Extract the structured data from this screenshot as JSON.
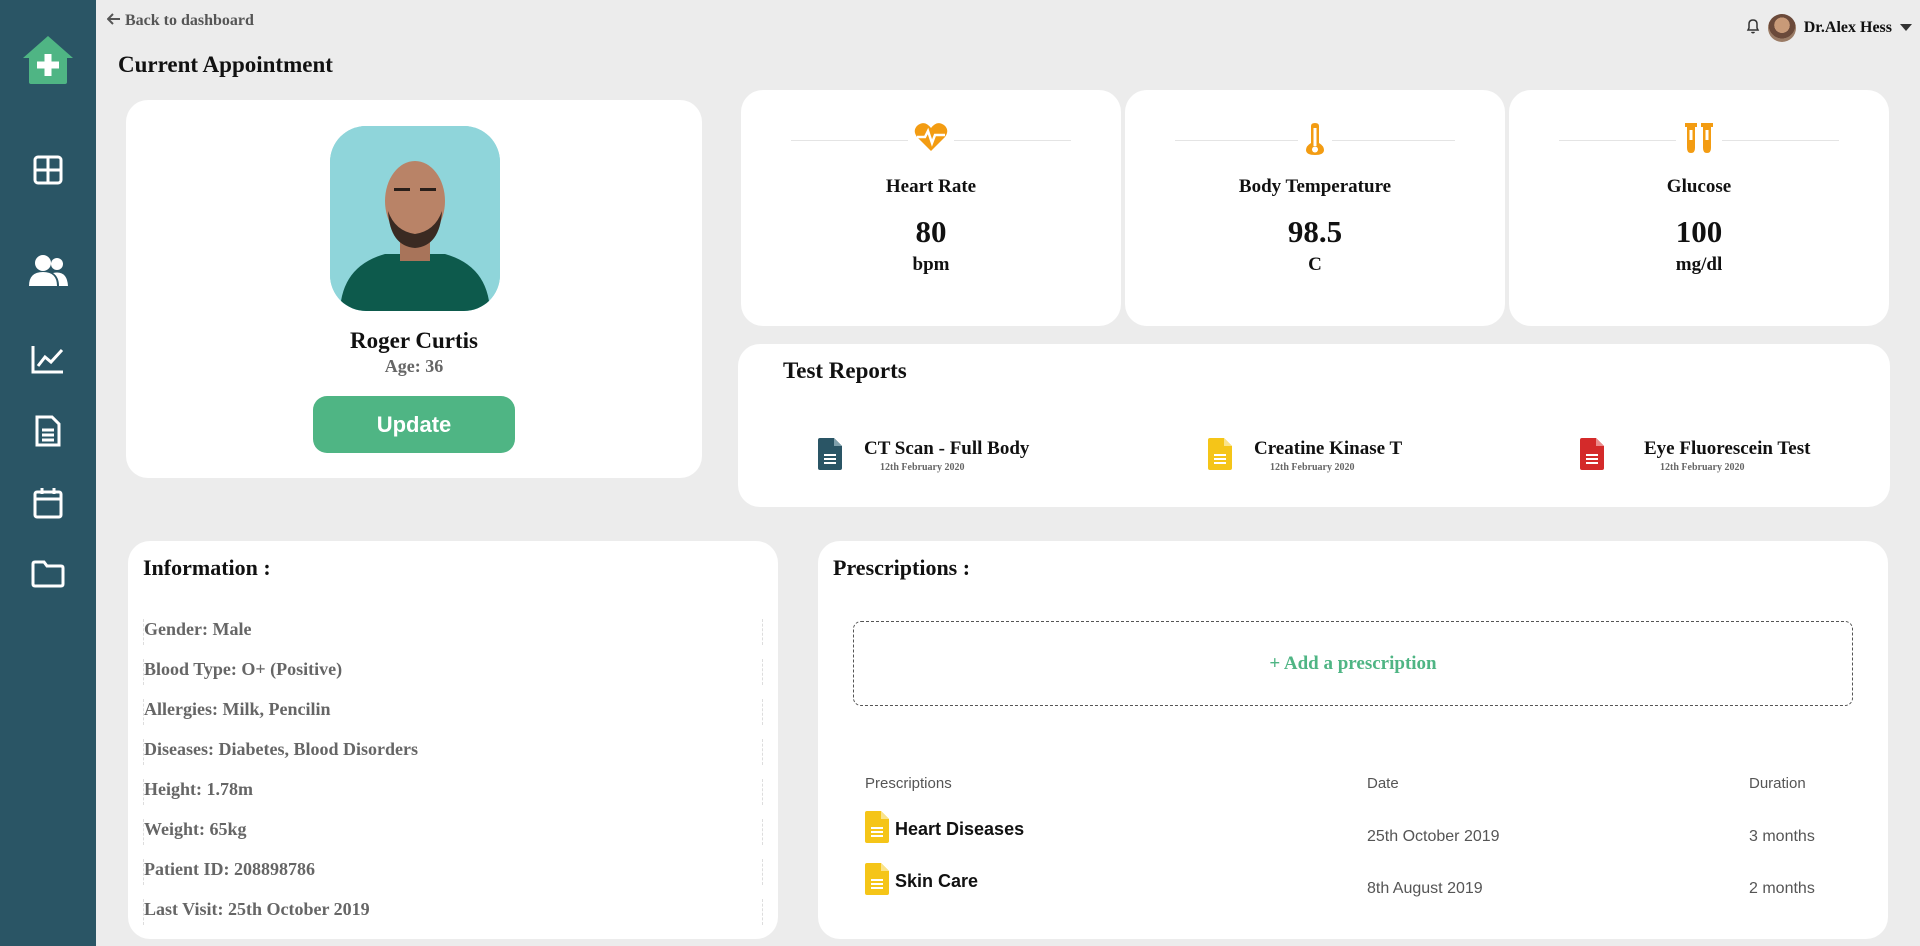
{
  "nav": {
    "back_label": "Back to dashboard",
    "page_title": "Current Appointment"
  },
  "user": {
    "name": "Dr.Alex Hess"
  },
  "patient": {
    "name": "Roger Curtis",
    "age_label": "Age: 36",
    "update_label": "Update"
  },
  "vitals": [
    {
      "label": "Heart Rate",
      "value": "80",
      "unit": "bpm",
      "icon": "heart-pulse-icon"
    },
    {
      "label": "Body Temperature",
      "value": "98.5",
      "unit": "C",
      "icon": "thermometer-icon"
    },
    {
      "label": "Glucose",
      "value": "100",
      "unit": "mg/dl",
      "icon": "test-tubes-icon"
    }
  ],
  "reports": {
    "title": "Test Reports",
    "items": [
      {
        "name": "CT Scan - Full Body",
        "date": "12th February 2020",
        "color": "#2a5565"
      },
      {
        "name": "Creatine Kinase T",
        "date": "12th February 2020",
        "color": "#f5c518"
      },
      {
        "name": "Eye Fluorescein Test",
        "date": "12th February 2020",
        "color": "#d42a2a"
      }
    ]
  },
  "information": {
    "title": "Information :",
    "rows": [
      "Gender: Male",
      "Blood Type: O+ (Positive)",
      "Allergies: Milk, Pencilin",
      "Diseases: Diabetes, Blood Disorders",
      "Height: 1.78m",
      "Weight: 65kg",
      "Patient ID: 208898786",
      "Last Visit: 25th October 2019"
    ]
  },
  "prescriptions": {
    "title": "Prescriptions :",
    "add_label": "+ Add a prescription",
    "columns": [
      "Prescriptions",
      "Date",
      "Duration"
    ],
    "rows": [
      {
        "name": "Heart Diseases",
        "date": "25th October 2019",
        "duration": "3 months"
      },
      {
        "name": "Skin Care",
        "date": "8th August 2019",
        "duration": "2 months"
      }
    ]
  },
  "colors": {
    "sidebar": "#2a5565",
    "accent_green": "#4fb584",
    "vital_orange": "#f39c12",
    "doc_yellow": "#f5c518"
  }
}
